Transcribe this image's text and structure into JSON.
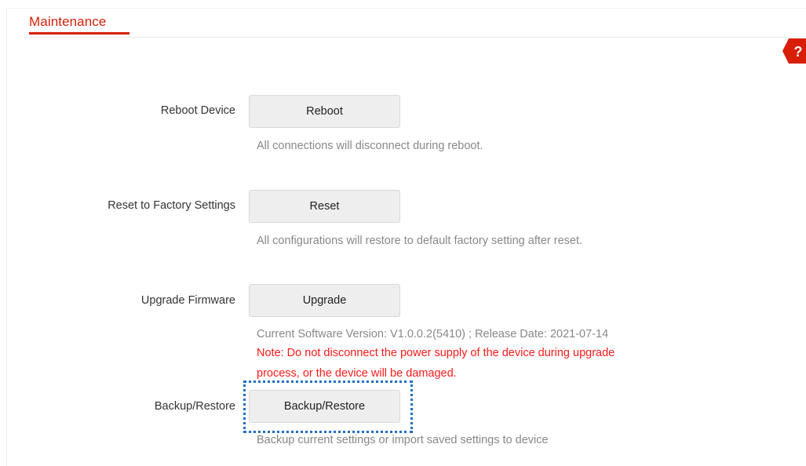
{
  "header": {
    "title": "Maintenance",
    "help_icon": "question-mark-icon",
    "help_glyph": "?"
  },
  "reboot": {
    "label": "Reboot Device",
    "button": "Reboot",
    "hint": "All connections will disconnect during reboot."
  },
  "reset": {
    "label": "Reset to Factory Settings",
    "button": "Reset",
    "hint": "All configurations will restore to default factory setting after reset."
  },
  "upgrade": {
    "label": "Upgrade Firmware",
    "button": "Upgrade",
    "version_info": "Current Software Version: V1.0.0.2(5410) ; Release Date: 2021-07-14",
    "note_line1": "Note: Do not disconnect the power supply of the device during upgrade",
    "note_line2": "process, or the device will be damaged."
  },
  "backup": {
    "label": "Backup/Restore",
    "button": "Backup/Restore",
    "hint": "Backup current settings or import saved settings to device"
  },
  "colors": {
    "accent": "#d81e06",
    "warning": "#ff1a1a",
    "hint": "#888888",
    "focus_outline": "#1f6fc6"
  }
}
